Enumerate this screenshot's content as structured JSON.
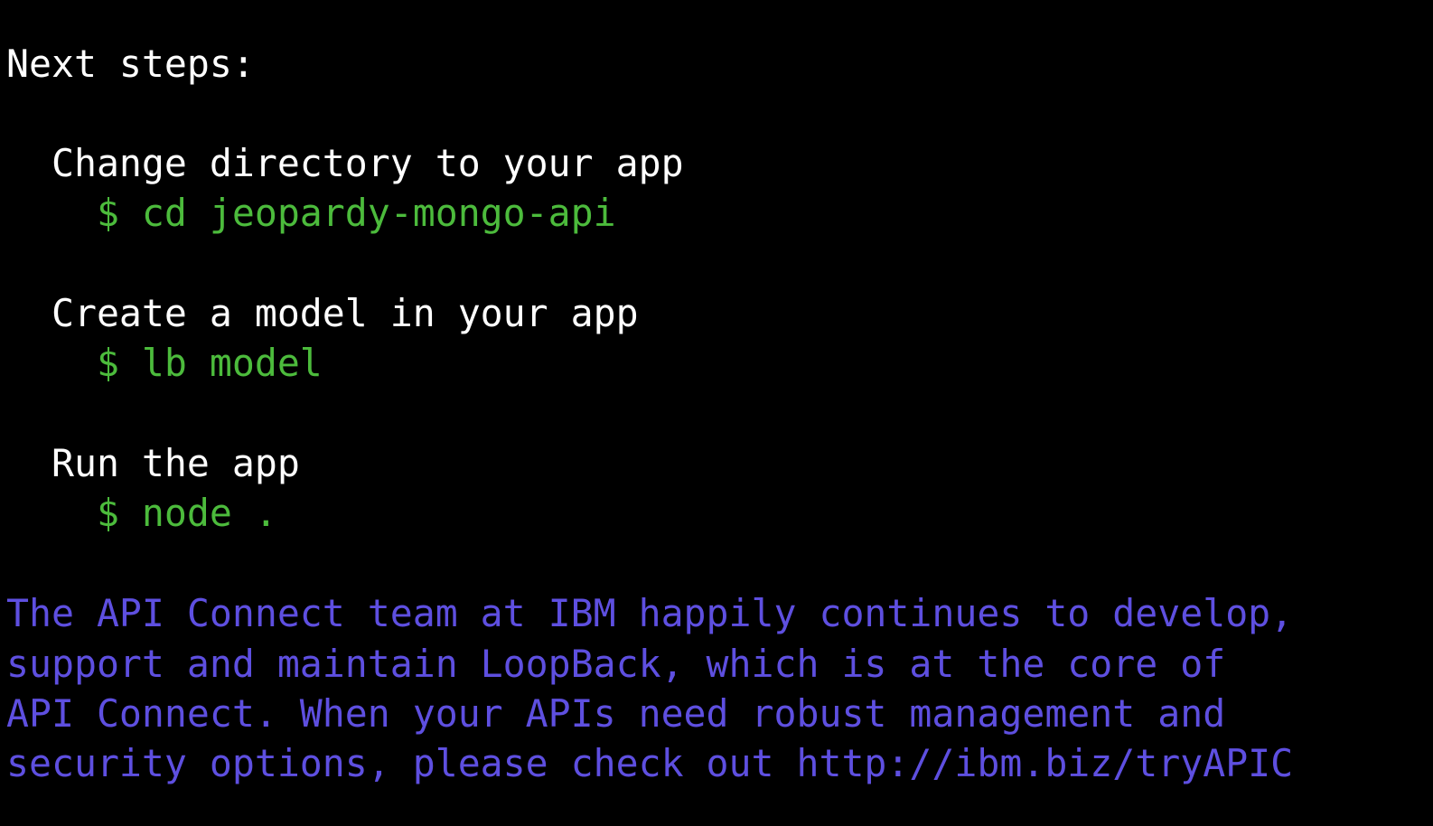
{
  "terminal": {
    "header": "Next steps:",
    "steps": [
      {
        "title": "  Change directory to your app",
        "command": "    $ cd jeopardy-mongo-api"
      },
      {
        "title": "  Create a model in your app",
        "command": "    $ lb model"
      },
      {
        "title": "  Run the app",
        "command": "    $ node ."
      }
    ],
    "notice": [
      "The API Connect team at IBM happily continues to develop,",
      "support and maintain LoopBack, which is at the core of",
      "API Connect. When your APIs need robust management and",
      "security options, please check out http://ibm.biz/tryAPIC"
    ],
    "colors": {
      "background": "#000000",
      "text": "#ffffff",
      "command": "#4cbb3c",
      "notice": "#5e4fe0"
    }
  }
}
